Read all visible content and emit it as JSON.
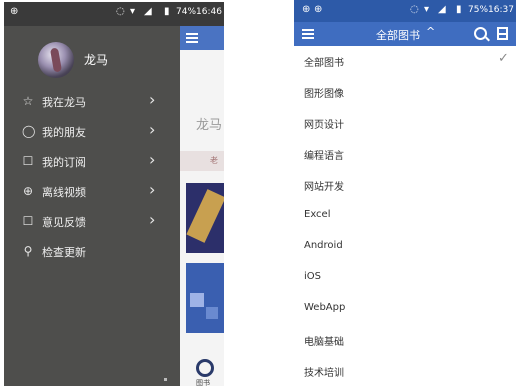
{
  "left_screen": {
    "status": {
      "time": "16:46",
      "battery": "74%"
    },
    "drawer": {
      "user_name": "龙马",
      "items": [
        {
          "label": "我在龙马",
          "icon": "star-icon",
          "arrow": "›"
        },
        {
          "label": "我的朋友",
          "icon": "chat-bubble-icon",
          "arrow": "›"
        },
        {
          "label": "我的订阅",
          "icon": "subscribe-icon",
          "arrow": "›"
        },
        {
          "label": "离线视频",
          "icon": "download-icon",
          "arrow": "›"
        },
        {
          "label": "意见反馈",
          "icon": "feedback-icon",
          "arrow": "›"
        },
        {
          "label": "检查更新",
          "icon": "search-icon"
        }
      ]
    },
    "background_app": {
      "title": "龙马",
      "strip_label": "老",
      "bottom_label": "图书"
    }
  },
  "right_screen": {
    "status": {
      "time": "16:37",
      "battery": "75%"
    },
    "toolbar": {
      "title": "全部图书",
      "caret": "^"
    },
    "categories": [
      {
        "label": "全部图书",
        "selected": true
      },
      {
        "label": "图形图像"
      },
      {
        "label": "网页设计"
      },
      {
        "label": "编程语言"
      },
      {
        "label": "网站开发"
      },
      {
        "label": "Excel"
      },
      {
        "label": "Android"
      },
      {
        "label": "iOS"
      },
      {
        "label": "WebApp"
      },
      {
        "label": "电脑基础"
      },
      {
        "label": "技术培训"
      }
    ],
    "check_mark": "✓"
  },
  "colors": {
    "toolbar_blue": "#3f6dc0",
    "drawer_bg": "#4e4e4c"
  }
}
